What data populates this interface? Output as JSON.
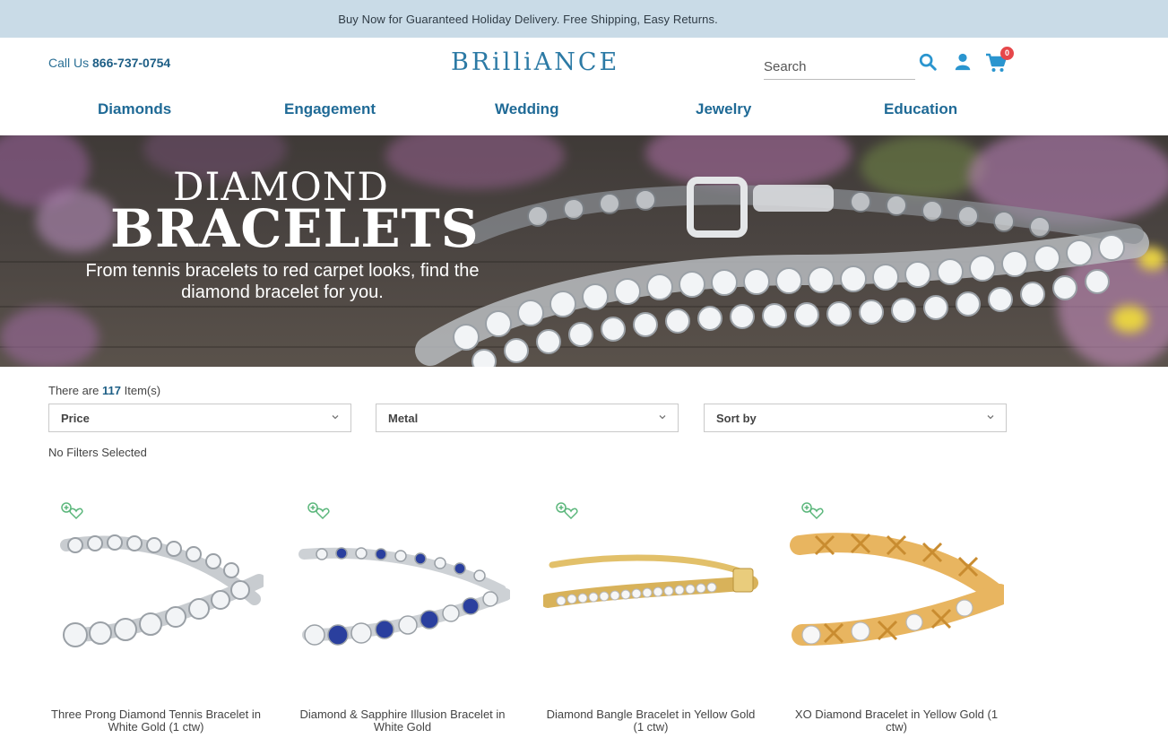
{
  "promo": {
    "text": "Buy Now for Guaranteed Holiday Delivery. Free Shipping, Easy Returns."
  },
  "header": {
    "phone_prefix": "Call Us",
    "phone_number": "866-737-0754",
    "logo": "BRilliANCE",
    "search_placeholder": "Search",
    "cart_count": "0"
  },
  "nav": {
    "items": [
      "Diamonds",
      "Engagement",
      "Wedding",
      "Jewelry",
      "Education"
    ]
  },
  "hero": {
    "title_line1": "DIAMOND",
    "title_line2": "BRACELETS",
    "subtitle": "From tennis bracelets to red carpet looks, find the diamond bracelet for you."
  },
  "listing": {
    "count_prefix": "There are",
    "count": "117",
    "count_suffix": "Item(s)",
    "filters": [
      "Price",
      "Metal",
      "Sort by"
    ],
    "no_filters": "No Filters Selected"
  },
  "products": [
    {
      "name": "Three Prong Diamond Tennis Bracelet in White Gold (1 ctw)",
      "metal": "#d9dde2",
      "stone": "#eef2f6"
    },
    {
      "name": "Diamond & Sapphire Illusion Bracelet in White Gold",
      "metal": "#d9dde2",
      "stone": "#2a3f9e"
    },
    {
      "name": "Diamond Bangle Bracelet in Yellow Gold (1 ctw)",
      "metal": "#e2c06a",
      "stone": "#f4f4f4"
    },
    {
      "name": "XO Diamond Bracelet in Yellow Gold (1 ctw)",
      "metal": "#e8b560",
      "stone": "#f6f6f6"
    }
  ],
  "colors": {
    "brand": "#2c7aa5",
    "promo_bg": "#c9dbe7",
    "icon": "#2a95cf",
    "badge": "#e6474a",
    "wishlist": "#5cb77c"
  }
}
